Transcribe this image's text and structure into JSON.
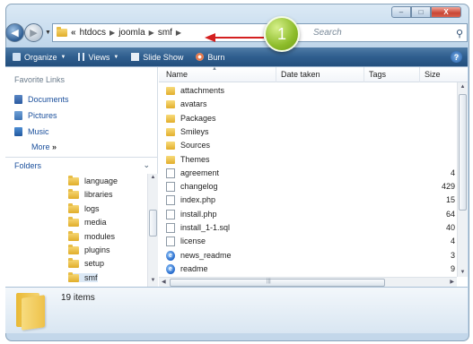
{
  "window": {
    "caption_buttons": {
      "minimize": "–",
      "maximize": "□",
      "close": "X"
    }
  },
  "address": {
    "prefix": "«",
    "crumbs": [
      "htdocs",
      "joomla",
      "smf"
    ],
    "search_placeholder": "Search"
  },
  "callout": {
    "number": "1",
    "color": "#8dbc2a",
    "arrow_color": "#d42020"
  },
  "toolbar": {
    "organize": "Organize",
    "views": "Views",
    "slideshow": "Slide Show",
    "burn": "Burn",
    "help": "?"
  },
  "favorites": {
    "title": "Favorite Links",
    "items": [
      "Documents",
      "Pictures",
      "Music"
    ],
    "more": "More",
    "more_glyph": "»"
  },
  "folders": {
    "title": "Folders",
    "tree": [
      "language",
      "libraries",
      "logs",
      "media",
      "modules",
      "plugins",
      "setup",
      "smf"
    ],
    "selected": "smf"
  },
  "columns": {
    "name": "Name",
    "date": "Date taken",
    "tags": "Tags",
    "size": "Size"
  },
  "files": [
    {
      "name": "attachments",
      "type": "folder",
      "size": ""
    },
    {
      "name": "avatars",
      "type": "folder",
      "size": ""
    },
    {
      "name": "Packages",
      "type": "folder",
      "size": ""
    },
    {
      "name": "Smileys",
      "type": "folder",
      "size": ""
    },
    {
      "name": "Sources",
      "type": "folder",
      "size": ""
    },
    {
      "name": "Themes",
      "type": "folder",
      "size": ""
    },
    {
      "name": "agreement",
      "type": "file",
      "size": "4"
    },
    {
      "name": "changelog",
      "type": "file",
      "size": "429"
    },
    {
      "name": "index.php",
      "type": "file",
      "size": "15"
    },
    {
      "name": "install.php",
      "type": "file",
      "size": "64"
    },
    {
      "name": "install_1-1.sql",
      "type": "file",
      "size": "40"
    },
    {
      "name": "license",
      "type": "file",
      "size": "4"
    },
    {
      "name": "news_readme",
      "type": "ie",
      "size": "3"
    },
    {
      "name": "readme",
      "type": "ie",
      "size": "9"
    }
  ],
  "details": {
    "count": "19 items"
  }
}
